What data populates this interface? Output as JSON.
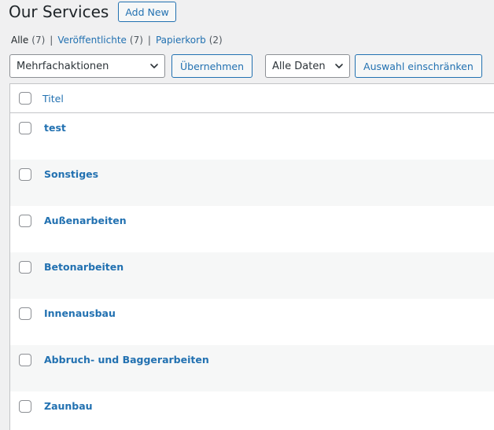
{
  "header": {
    "title": "Our Services",
    "add_new_label": "Add New"
  },
  "filters": [
    {
      "label": "Alle",
      "count": "(7)"
    },
    {
      "label": "Veröffentlichte",
      "count": "(7)"
    },
    {
      "label": "Papierkorb",
      "count": "(2)"
    }
  ],
  "toolbar": {
    "bulk_actions": "Mehrfachaktionen",
    "apply_label": "Übernehmen",
    "dates": "Alle Daten",
    "filter_label": "Auswahl einschränken"
  },
  "table": {
    "column_title": "Titel",
    "rows": [
      "test",
      "Sonstiges",
      "Außenarbeiten",
      "Betonarbeiten",
      "Innenausbau",
      "Abbruch- und Baggerarbeiten",
      "Zaunbau"
    ]
  },
  "colors": {
    "link": "#2271b1",
    "border": "#c3c4c7",
    "background": "#f0f0f1"
  },
  "icons": {
    "select_arrow": "chevron-down-icon"
  }
}
